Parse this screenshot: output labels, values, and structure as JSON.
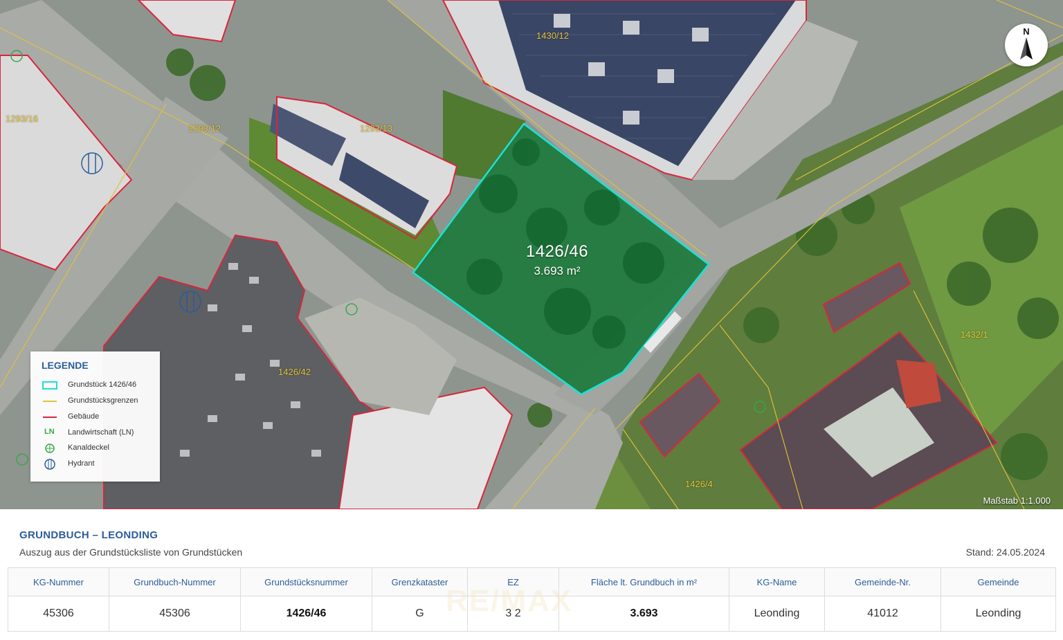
{
  "map": {
    "plot": {
      "id": "1426/46",
      "area": "3.693 m²",
      "outline_color": "#19e3d6"
    },
    "parcel_labels": [
      "1430/12",
      "1293/16",
      "1293/12",
      "1293/13",
      "1426/42",
      "1426/4",
      "1432/1"
    ],
    "compass": {
      "letter": "N",
      "icon": "north-arrow-icon"
    },
    "scale": "Maßstab 1:1.000",
    "legend": {
      "title": "LEGENDE",
      "items": [
        {
          "label": "Grundstück 1426/46",
          "icon": "plot-outline-icon",
          "color": "#19e3d6"
        },
        {
          "label": "Grundstücksgrenzen",
          "icon": "boundary-line-icon",
          "color": "#e0c23a"
        },
        {
          "label": "Gebäude",
          "icon": "building-line-icon",
          "color": "#d7263d"
        },
        {
          "label": "Landwirtschaft (LN)",
          "icon": "ln-icon",
          "symbol": "LN",
          "color": "#3aa64a"
        },
        {
          "label": "Kanaldeckel",
          "icon": "manhole-icon",
          "color": "#3aa64a"
        },
        {
          "label": "Hydrant",
          "icon": "hydrant-icon",
          "color": "#2b5c9c"
        }
      ]
    }
  },
  "info": {
    "title": "GRUNDBUCH – LEONDING",
    "subtitle": "Auszug aus der Grundstücksliste von Grundstücken",
    "stand": "Stand: 24.05.2024",
    "watermark": "RE/MAX",
    "columns": [
      "KG-Nummer",
      "Grundbuch-Nummer",
      "Grundstücksnummer",
      "Grenzkataster",
      "EZ",
      "Fläche lt. Grundbuch in m²",
      "KG-Name",
      "Gemeinde-Nr.",
      "Gemeinde"
    ],
    "row": [
      "45306",
      "45306",
      "1426/46",
      "G",
      "3 2",
      "3.693",
      "Leonding",
      "41012",
      "Leonding"
    ]
  }
}
